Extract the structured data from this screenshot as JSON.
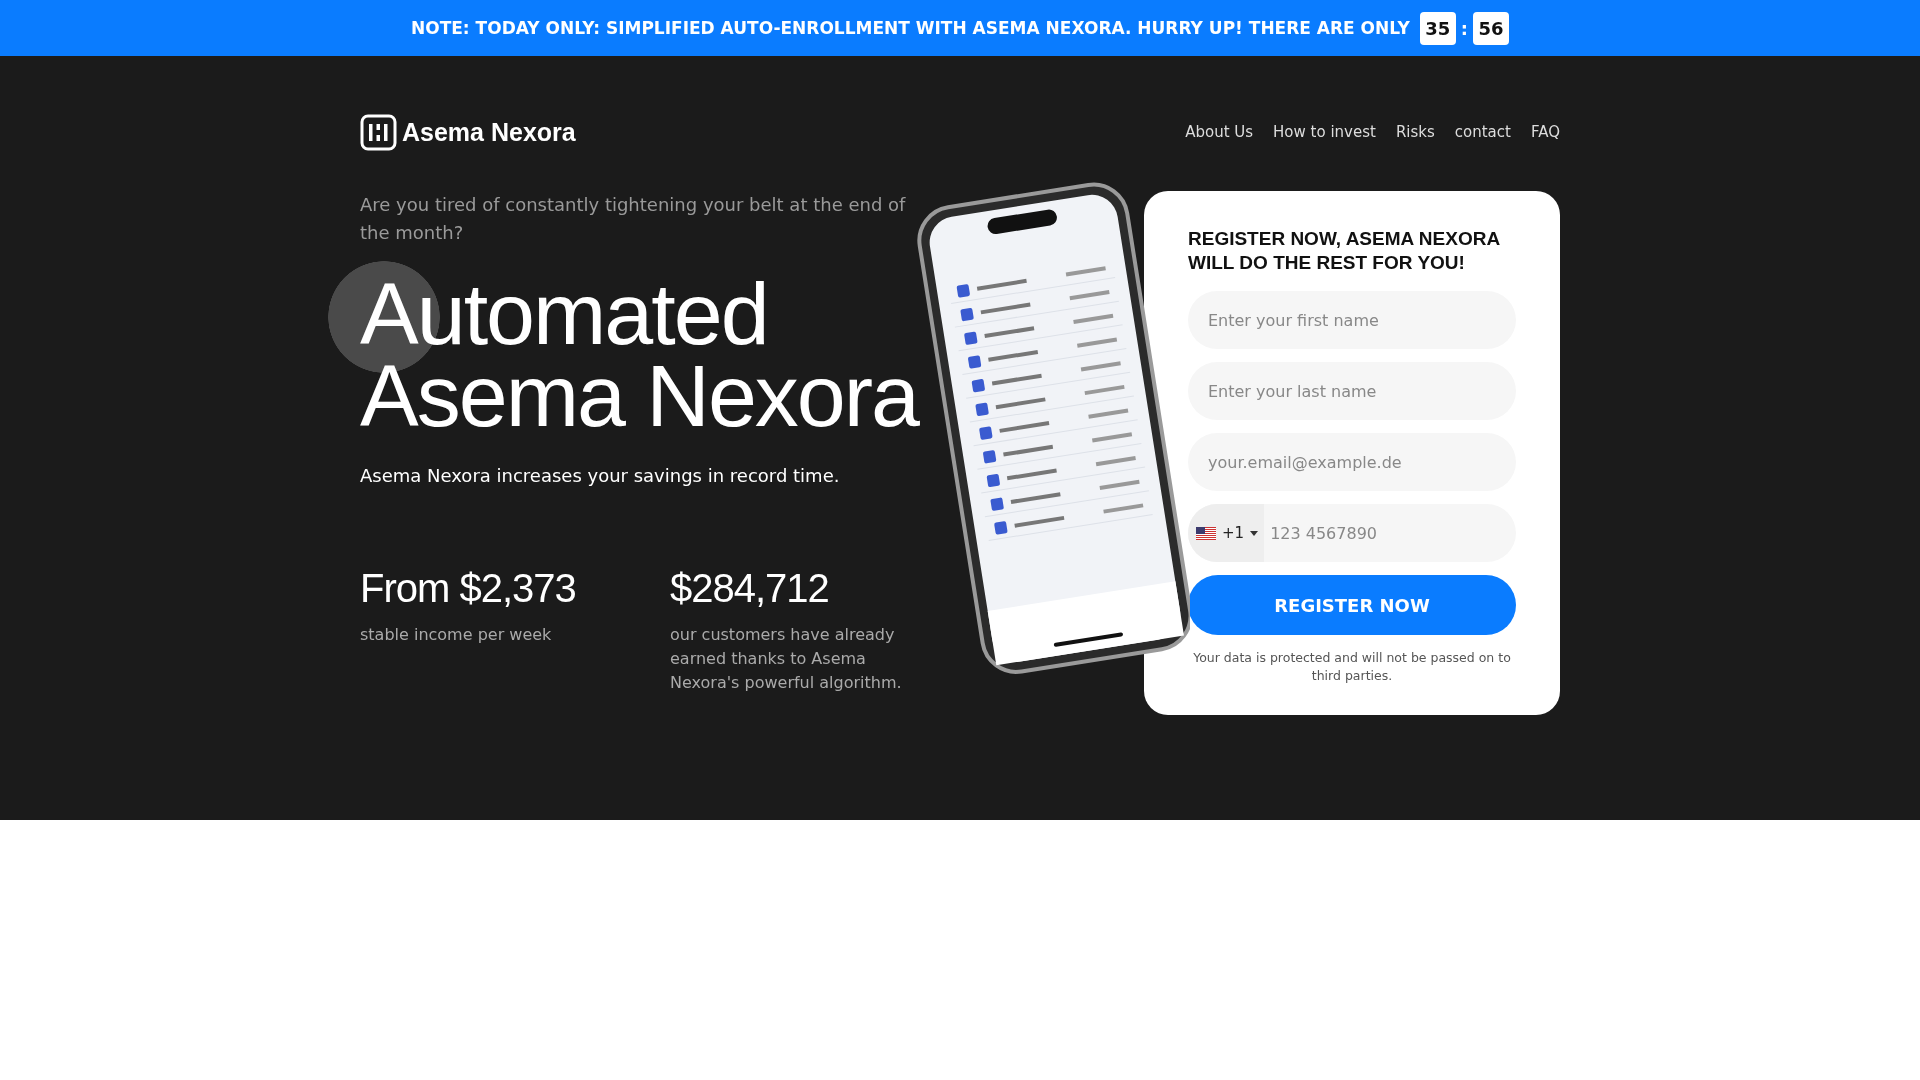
{
  "banner": {
    "text": "NOTE: TODAY ONLY: SIMPLIFIED AUTO-ENROLLMENT WITH ASEMA NEXORA. HURRY UP! THERE ARE ONLY",
    "timer": [
      "35",
      "56"
    ],
    "separator": ":"
  },
  "header": {
    "logo": "Asema Nexora",
    "nav": [
      "About Us",
      "How to invest",
      "Risks",
      "contact",
      "FAQ"
    ]
  },
  "hero": {
    "intro": "Are you tired of constantly tightening your belt at the end of the month?",
    "title_lines": [
      "Automated",
      "Asema Nexora"
    ],
    "subtitle": "Asema Nexora increases your savings in record time.",
    "stats": [
      {
        "value": "From $2,373",
        "caption": "stable income per week"
      },
      {
        "value": "$284,712",
        "caption": "our customers have already earned thanks to Asema Nexora's powerful algorithm."
      }
    ]
  },
  "form": {
    "title": "REGISTER NOW, ASEMA NEXORA WILL DO THE REST FOR YOU!",
    "fields": [
      {
        "placeholder": "Enter your first name"
      },
      {
        "placeholder": "Enter your last name"
      },
      {
        "placeholder": "your.email@example.de"
      }
    ],
    "phone": {
      "code": "+1",
      "placeholder": "123 4567890"
    },
    "button": "REGISTER NOW",
    "note": "Your data is protected and will not be passed on to third parties."
  }
}
